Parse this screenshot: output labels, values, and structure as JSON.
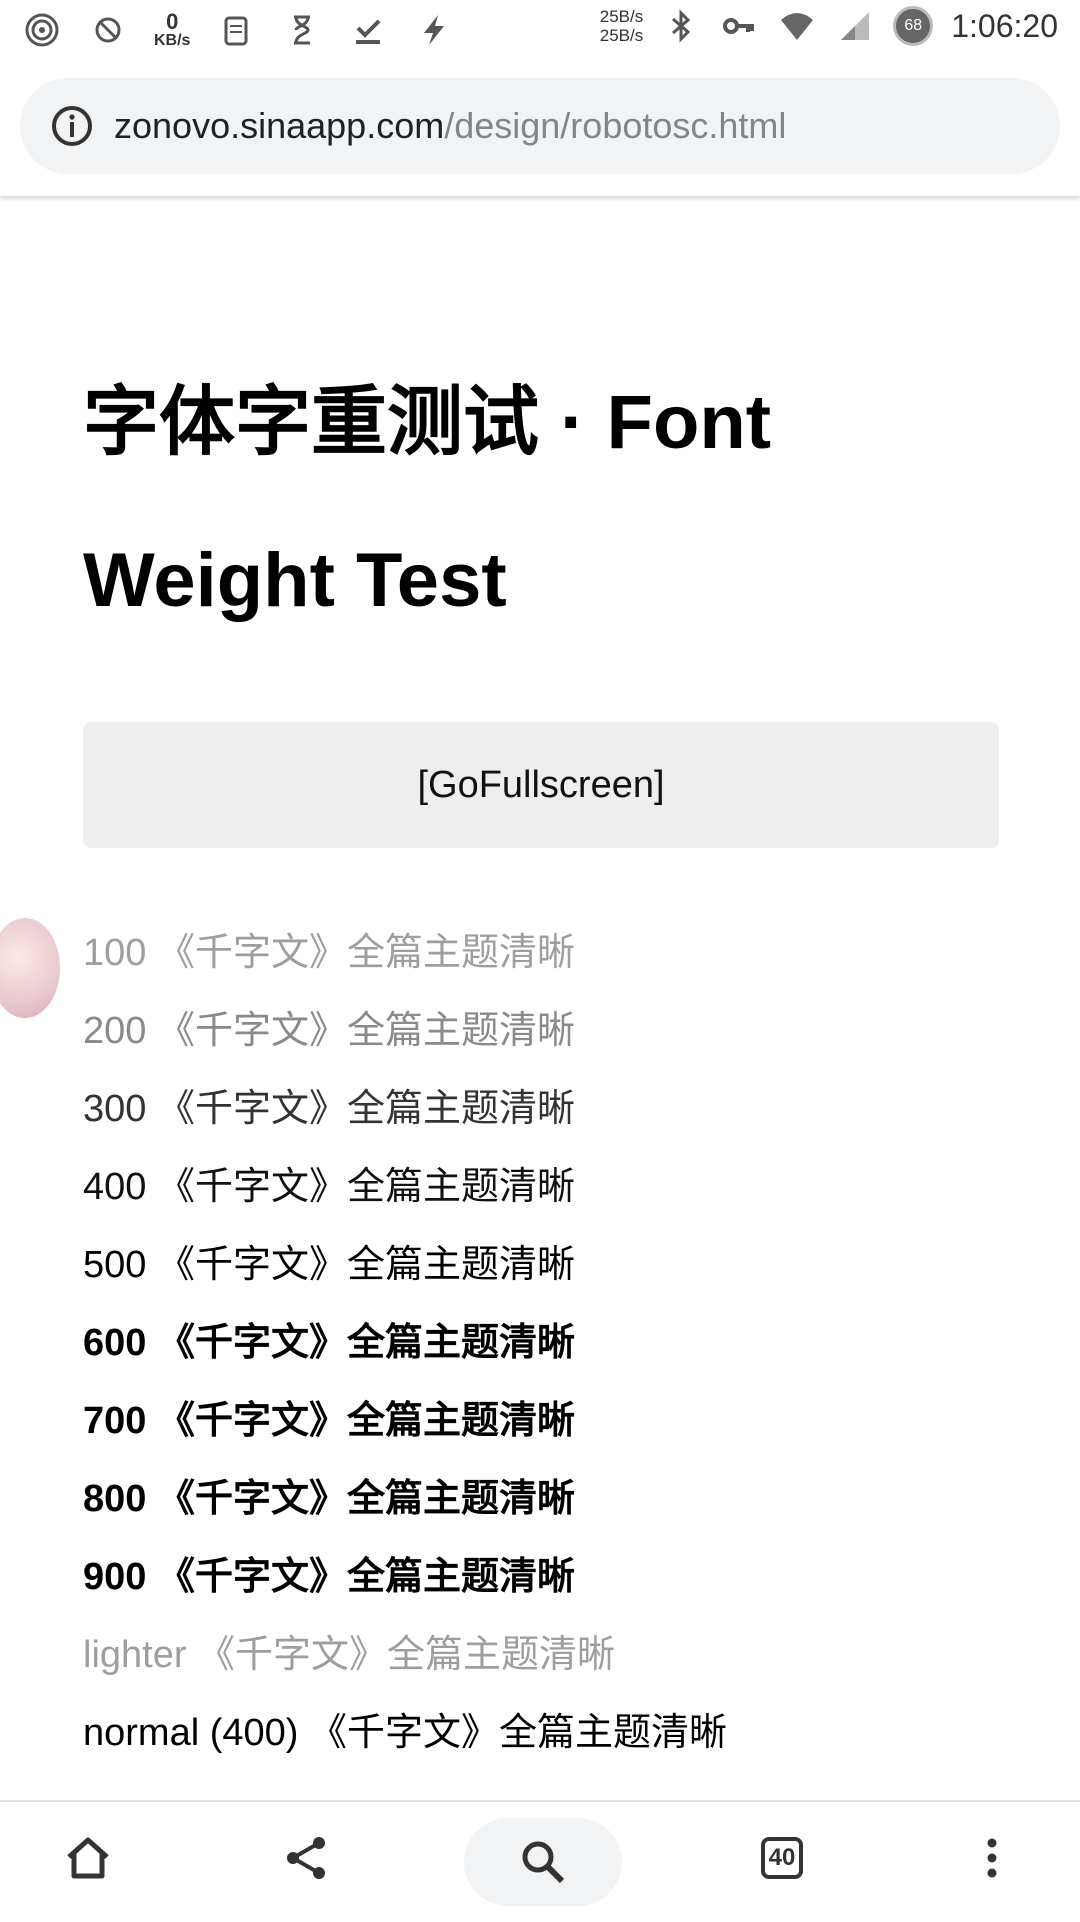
{
  "status_bar": {
    "left_speed_value": "0",
    "left_speed_unit": "KB/s",
    "up_speed": "25B/s",
    "down_speed": "25B/s",
    "battery": "68",
    "time": "1:06:20"
  },
  "address_bar": {
    "url_host": "zonovo.sinaapp.com",
    "url_path": "/design/robotosc.html"
  },
  "page": {
    "title": "字体字重测试 · Font Weight Test",
    "fullscreen_button": "[GoFullscreen]",
    "weight_lines": [
      {
        "label": "100 《千字文》全篇主题清晰"
      },
      {
        "label": "200 《千字文》全篇主题清晰"
      },
      {
        "label": "300 《千字文》全篇主题清晰"
      },
      {
        "label": "400 《千字文》全篇主题清晰"
      },
      {
        "label": "500 《千字文》全篇主题清晰"
      },
      {
        "label": "600 《千字文》全篇主题清晰"
      },
      {
        "label": "700 《千字文》全篇主题清晰"
      },
      {
        "label": "800 《千字文》全篇主题清晰"
      },
      {
        "label": "900 《千字文》全篇主题清晰"
      },
      {
        "label": "lighter 《千字文》全篇主题清晰"
      },
      {
        "label": "normal (400) 《千字文》全篇主题清晰"
      }
    ]
  },
  "bottom_nav": {
    "tab_count": "40"
  }
}
